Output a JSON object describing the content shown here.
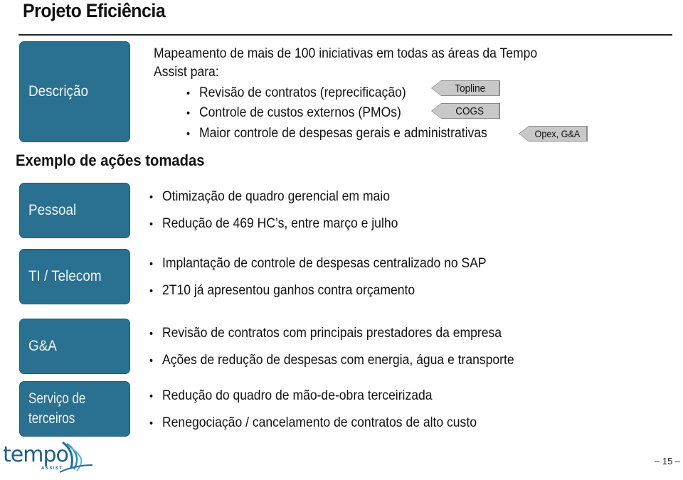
{
  "header": {
    "title": "Projeto Eficiência"
  },
  "description": {
    "label": "Descrição",
    "intro_line1": "Mapeamento de mais de 100 iniciativas em todas as áreas da Tempo",
    "intro_line2": "Assist para:",
    "items": [
      {
        "text": "Revisão de contratos (reprecificação)",
        "tag": "Topline"
      },
      {
        "text": "Controle de custos externos (PMOs)",
        "tag": "COGS"
      },
      {
        "text": "Maior controle de despesas gerais e administrativas",
        "tag": "Opex, G&A"
      }
    ]
  },
  "actions": {
    "heading": "Exemplo de ações tomadas",
    "categories": [
      {
        "label": "Pessoal",
        "bullets": [
          "Otimização de quadro gerencial em maio",
          "Redução de 469 HC’s, entre março e julho"
        ]
      },
      {
        "label": "TI / Telecom",
        "bullets": [
          "Implantação de controle de despesas centralizado no SAP",
          "2T10 já apresentou ganhos contra orçamento"
        ]
      },
      {
        "label": "G&A",
        "bullets": [
          "Revisão de contratos com principais prestadores da empresa",
          "Ações de redução de despesas com energia, água e transporte"
        ]
      },
      {
        "label_line1": "Serviço de",
        "label_line2": "terceiros",
        "bullets": [
          "Redução do quadro de mão-de-obra terceirizada",
          "Renegociação / cancelamento de contratos de alto custo"
        ]
      }
    ]
  },
  "footer": {
    "logo_text": "tempo",
    "logo_subtext": "ASSIST",
    "page_number": "– 15 –"
  },
  "colors": {
    "box_fill": "#2a7091",
    "box_border": "#1f5f6e",
    "tag_fill": "#c8c8c8",
    "logo_blue": "#1d6fa3"
  }
}
